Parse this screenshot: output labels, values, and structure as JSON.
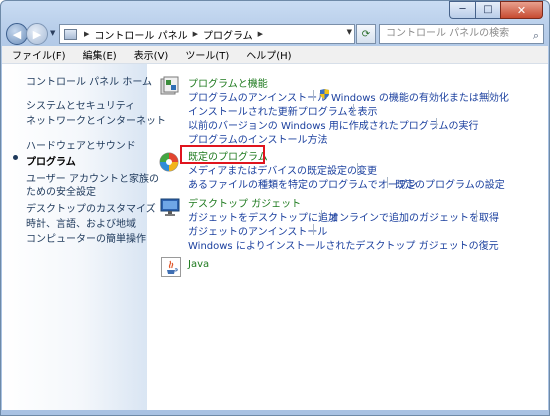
{
  "window": {
    "caption": {
      "minimize": "─",
      "maximize": "□",
      "close": "✕"
    }
  },
  "nav": {
    "back_glyph": "◀",
    "forward_glyph": "▶",
    "breadcrumb": [
      "コントロール パネル",
      "プログラム"
    ],
    "search_placeholder": "コントロール パネルの検索"
  },
  "menubar": [
    "ファイル(F)",
    "編集(E)",
    "表示(V)",
    "ツール(T)",
    "ヘルプ(H)"
  ],
  "sidebar": {
    "home": "コントロール パネル ホーム",
    "items": [
      "システムとセキュリティ",
      "ネットワークとインターネット",
      "ハードウェアとサウンド",
      "プログラム",
      "ユーザー アカウントと家族の",
      "ための安全設定",
      "デスクトップのカスタマイズ",
      "時計、言語、および地域",
      "コンピューターの簡単操作"
    ],
    "current_index": 3
  },
  "categories": {
    "programs_features": {
      "title": "プログラムと機能",
      "links": [
        "プログラムのアンインストール",
        "Windows の機能の有効化または無効化",
        "インストールされた更新プログラムを表示",
        "以前のバージョンの Windows 用に作成されたプログラムの実行",
        "プログラムのインストール方法"
      ]
    },
    "default_programs": {
      "title": "既定のプログラム",
      "links": [
        "メディアまたはデバイスの既定設定の変更",
        "あるファイルの種類を特定のプログラムでオープン",
        "既定のプログラムの設定"
      ]
    },
    "desktop_gadgets": {
      "title": "デスクトップ ガジェット",
      "links": [
        "ガジェットをデスクトップに追加",
        "オンラインで追加のガジェットを取得",
        "ガジェットのアンインストール",
        "Windows によりインストールされたデスクトップ ガジェットの復元"
      ]
    },
    "java": {
      "title": "Java"
    }
  },
  "colors": {
    "category_title": "#1e7a1e",
    "link": "#1a3f9e",
    "highlight": "#e0141e",
    "sidebar_text": "#1e395b"
  }
}
